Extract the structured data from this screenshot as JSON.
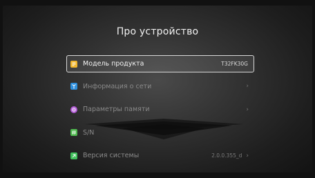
{
  "page": {
    "title": "Про устройство"
  },
  "menu": {
    "items": [
      {
        "label": "Модель продукта",
        "value": "T32FK30G",
        "icon": "document-icon",
        "color": "#f2b62c"
      },
      {
        "label": "Информация о сети",
        "value": "",
        "icon": "antenna-icon",
        "color": "#2f8fdc"
      },
      {
        "label": "Параметры памяти",
        "value": "",
        "icon": "memory-icon",
        "color": "#b25ad6"
      },
      {
        "label": "S/N",
        "value": "",
        "icon": "hash-icon",
        "color": "#4fb84f"
      },
      {
        "label": "Версия системы",
        "value": "2.0.0.355_d",
        "icon": "system-icon",
        "color": "#3fbf5a"
      }
    ],
    "chevron": "›"
  }
}
